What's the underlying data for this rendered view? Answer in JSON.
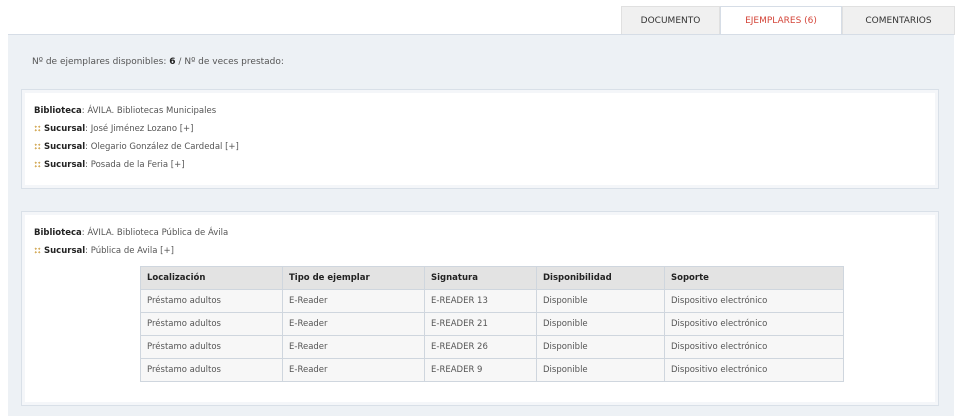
{
  "tabs": [
    {
      "label": "DOCUMENTO"
    },
    {
      "label": "EJEMPLARES (6)"
    },
    {
      "label": "COMENTARIOS"
    }
  ],
  "summary": {
    "disponibles_label": "Nº de ejemplares disponibles:",
    "disponibles_value": "6",
    "separator": "/",
    "prestado_label": "Nº de veces prestado:"
  },
  "bibliotecas": [
    {
      "label": "Biblioteca",
      "name": "ÁVILA. Bibliotecas Municipales",
      "sucursales": [
        {
          "label": "Sucursal",
          "name": "José Jiménez Lozano",
          "toggle": "[+]"
        },
        {
          "label": "Sucursal",
          "name": "Olegario González de Cardedal",
          "toggle": "[+]"
        },
        {
          "label": "Sucursal",
          "name": "Posada de la Feria",
          "toggle": "[+]"
        }
      ]
    },
    {
      "label": "Biblioteca",
      "name": "ÁVILA. Biblioteca Pública de Ávila",
      "sucursales": [
        {
          "label": "Sucursal",
          "name": "Pública de Avila",
          "toggle": "[+]"
        }
      ]
    }
  ],
  "table": {
    "headers": [
      "Localización",
      "Tipo de ejemplar",
      "Signatura",
      "Disponibilidad",
      "Soporte"
    ],
    "rows": [
      [
        "Préstamo adultos",
        "E-Reader",
        "E-READER 13",
        "Disponible",
        "Dispositivo electrónico"
      ],
      [
        "Préstamo adultos",
        "E-Reader",
        "E-READER 21",
        "Disponible",
        "Dispositivo electrónico"
      ],
      [
        "Préstamo adultos",
        "E-Reader",
        "E-READER 26",
        "Disponible",
        "Dispositivo electrónico"
      ],
      [
        "Préstamo adultos",
        "E-Reader",
        "E-READER 9",
        "Disponible",
        "Dispositivo electrónico"
      ]
    ]
  },
  "colors": {
    "active_tab_text": "#d4463a",
    "panel_background": "#edf1f5",
    "branch_icon": "#d4ac5c"
  }
}
